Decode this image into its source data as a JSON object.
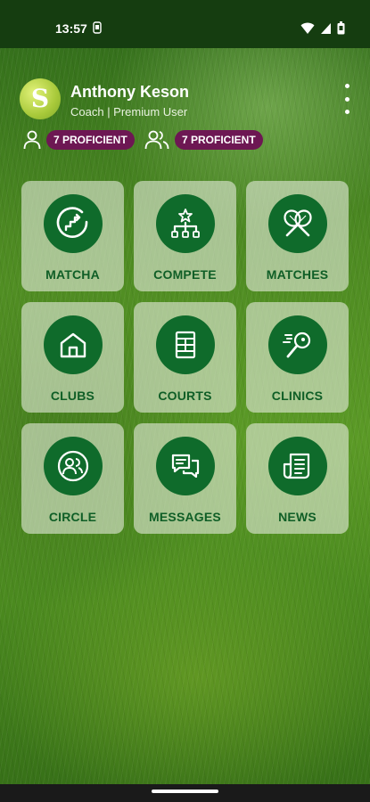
{
  "status_bar": {
    "time": "13:57",
    "left_icon": "sim-card-icon",
    "right_icons": [
      "wifi-icon",
      "signal-icon",
      "battery-icon"
    ]
  },
  "profile": {
    "logo_letter": "S",
    "name": "Anthony Keson",
    "role": "Coach | Premium User"
  },
  "badges": [
    {
      "icon": "person-icon",
      "label": "7 PROFICIENT"
    },
    {
      "icon": "group-icon",
      "label": "7 PROFICIENT"
    }
  ],
  "menu": {
    "icon": "more-vertical-icon"
  },
  "tiles": [
    {
      "label": "MATCHA",
      "icon": "progress-stairs-icon"
    },
    {
      "label": "COMPETE",
      "icon": "tournament-bracket-icon"
    },
    {
      "label": "MATCHES",
      "icon": "crossed-rackets-icon"
    },
    {
      "label": "CLUBS",
      "icon": "home-icon"
    },
    {
      "label": "COURTS",
      "icon": "court-icon"
    },
    {
      "label": "CLINICS",
      "icon": "racket-ball-icon"
    },
    {
      "label": "CIRCLE",
      "icon": "circle-people-icon"
    },
    {
      "label": "MESSAGES",
      "icon": "chat-bubbles-icon"
    },
    {
      "label": "NEWS",
      "icon": "newspaper-icon"
    }
  ],
  "colors": {
    "status_bar": "#153d10",
    "tile_bg": "#e1e8d7",
    "icon_circle": "#0f6b2b",
    "tile_text": "#0f5e26",
    "badge": "#6d1753"
  }
}
